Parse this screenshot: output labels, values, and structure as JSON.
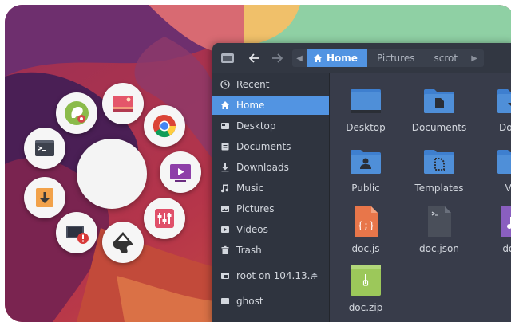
{
  "file_manager": {
    "breadcrumbs": [
      {
        "label": "Home",
        "active": true
      },
      {
        "label": "Pictures",
        "active": false
      },
      {
        "label": "scrot",
        "active": false
      }
    ],
    "sidebar": [
      {
        "label": "Recent",
        "icon": "clock-icon"
      },
      {
        "label": "Home",
        "icon": "home-icon",
        "active": true
      },
      {
        "label": "Desktop",
        "icon": "desktop-icon"
      },
      {
        "label": "Documents",
        "icon": "documents-icon"
      },
      {
        "label": "Downloads",
        "icon": "downloads-icon"
      },
      {
        "label": "Music",
        "icon": "music-icon"
      },
      {
        "label": "Pictures",
        "icon": "pictures-icon"
      },
      {
        "label": "Videos",
        "icon": "videos-icon"
      },
      {
        "label": "Trash",
        "icon": "trash-icon"
      },
      {
        "label": "root on 104.13...",
        "icon": "network-drive-icon",
        "eject": true
      },
      {
        "label": "ghost",
        "icon": "drive-icon"
      }
    ],
    "files": [
      {
        "name": "Desktop",
        "type": "folder-desktop"
      },
      {
        "name": "Documents",
        "type": "folder-documents"
      },
      {
        "name": "Down",
        "type": "folder-downloads"
      },
      {
        "name": "Public",
        "type": "folder-public"
      },
      {
        "name": "Templates",
        "type": "folder-templates"
      },
      {
        "name": "Vid",
        "type": "folder-videos"
      },
      {
        "name": "doc.js",
        "type": "file-js"
      },
      {
        "name": "doc.json",
        "type": "file-json"
      },
      {
        "name": "doc.",
        "type": "file-music"
      },
      {
        "name": "doc.zip",
        "type": "file-zip"
      }
    ]
  },
  "launcher": {
    "apps": [
      "gnome-tweaks-icon",
      "image-viewer-icon",
      "chrome-icon",
      "screen-recorder-icon",
      "mixer-icon",
      "inkscape-icon",
      "system-monitor-error-icon",
      "download-manager-icon",
      "terminal-icon"
    ]
  },
  "colors": {
    "accent": "#5294e2",
    "folder": "#4f8fd8",
    "sidebar_bg": "#2f343f",
    "content_bg": "#383c4a"
  }
}
